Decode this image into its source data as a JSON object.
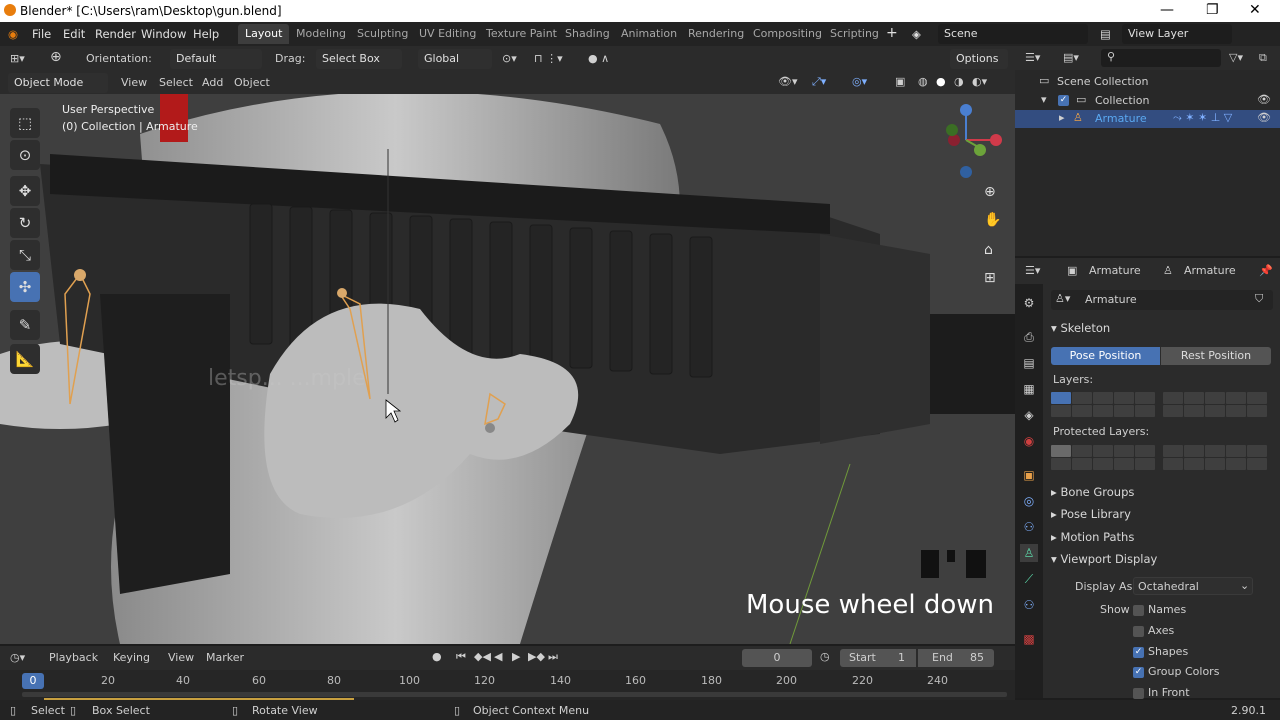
{
  "window": {
    "title": "Blender* [C:\\Users\\ram\\Desktop\\gun.blend]",
    "controls": [
      "minimize-icon",
      "restore-icon",
      "close-icon"
    ]
  },
  "menubar": {
    "menus": [
      "File",
      "Edit",
      "Render",
      "Window",
      "Help"
    ],
    "workspaces": [
      "Layout",
      "Modeling",
      "Sculpting",
      "UV Editing",
      "Texture Paint",
      "Shading",
      "Animation",
      "Rendering",
      "Compositing",
      "Scripting"
    ],
    "active_workspace": "Layout",
    "add_workspace": "+",
    "scene": "Scene",
    "view_layer": "View Layer"
  },
  "header": {
    "orientation_label": "Orientation:",
    "orientation_value": "Default",
    "drag_label": "Drag:",
    "drag_value": "Select Box",
    "transform_value": "Global",
    "options": "Options"
  },
  "viewport_header": {
    "mode": "Object Mode",
    "menus": [
      "View",
      "Select",
      "Add",
      "Object"
    ]
  },
  "viewport": {
    "perspective": "User Perspective",
    "collection_info": "(0) Collection | Armature",
    "watermark": "letsp... ...mple",
    "overlay_text": "Mouse wheel down"
  },
  "outliner": {
    "scene_collection": "Scene Collection",
    "collection": "Collection",
    "armature": "Armature"
  },
  "properties": {
    "breadcrumb_object": "Armature",
    "breadcrumb_data": "Armature",
    "name_field": "Armature",
    "skeleton_panel": "Skeleton",
    "pose_position": "Pose Position",
    "rest_position": "Rest Position",
    "layers_label": "Layers:",
    "protected_layers_label": "Protected Layers:",
    "panels": [
      "Bone Groups",
      "Pose Library",
      "Motion Paths",
      "Viewport Display"
    ],
    "display_as_label": "Display As",
    "display_as_value": "Octahedral",
    "show_label": "Show",
    "show_options": [
      {
        "label": "Names",
        "checked": false
      },
      {
        "label": "Axes",
        "checked": false
      },
      {
        "label": "Shapes",
        "checked": true
      },
      {
        "label": "Group Colors",
        "checked": true
      },
      {
        "label": "In Front",
        "checked": false
      }
    ]
  },
  "timeline": {
    "menus": [
      "Playback",
      "Keying",
      "View",
      "Marker"
    ],
    "current_frame": "0",
    "start_label": "Start",
    "start_value": "1",
    "end_label": "End",
    "end_value": "85",
    "playhead": "0",
    "ticks": [
      "20",
      "40",
      "60",
      "80",
      "100",
      "120",
      "140",
      "160",
      "180",
      "200",
      "220",
      "240"
    ]
  },
  "statusbar": {
    "select": "Select",
    "box_select": "Box Select",
    "rotate_view": "Rotate View",
    "context_menu": "Object Context Menu",
    "version": "2.90.1"
  },
  "colors": {
    "accent": "#4772b3",
    "armature_text": "#5aa8f0",
    "logo": "#e87d0d"
  }
}
